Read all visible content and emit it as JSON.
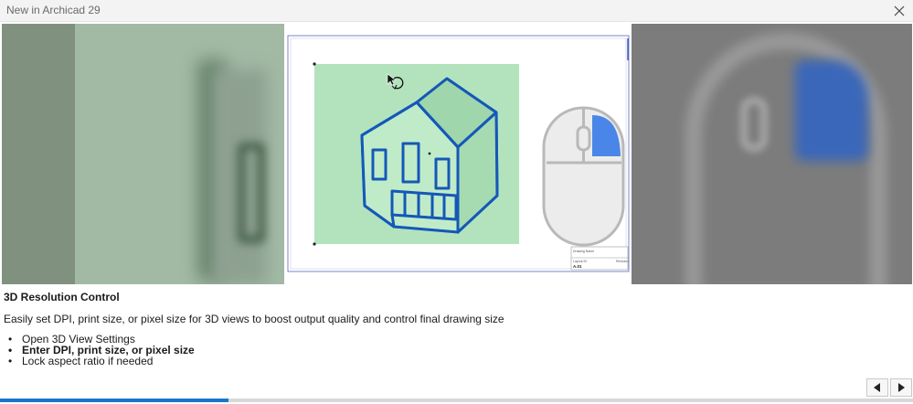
{
  "window": {
    "title": "New in Archicad 29"
  },
  "icons": {
    "close": "close-icon",
    "prev": "chevron-left-icon",
    "next": "chevron-right-icon",
    "cursor": "rotate-cursor-icon",
    "mouse": "mouse-scroll-icon"
  },
  "slide": {
    "heading": "3D Resolution Control",
    "description": "Easily set DPI, print size, or pixel size for 3D views to boost output quality and control final drawing size",
    "bullets": [
      {
        "text": "Open 3D View Settings",
        "bold": false
      },
      {
        "text": "Enter DPI, print size, or pixel size",
        "bold": true
      },
      {
        "text": "Lock aspect ratio if needed",
        "bold": false
      }
    ]
  },
  "drawing": {
    "title_block_label": "Drawing Name",
    "layout_label": "Layout ID",
    "revision_label": "Revision",
    "sheet_id": "A.01"
  },
  "progress": {
    "fraction": 0.25
  },
  "colors": {
    "accent": "#1a76c9",
    "house_fill": "#b3e3bd",
    "house_stroke": "#1458b8",
    "mouse_wheel": "#4a86e8"
  }
}
